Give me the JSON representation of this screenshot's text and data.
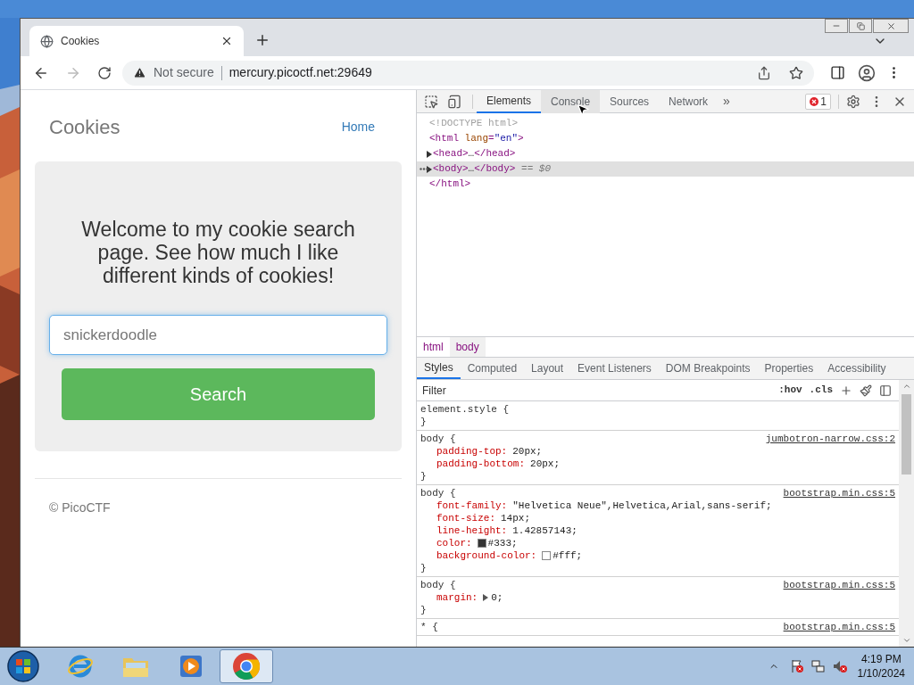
{
  "browser": {
    "tabs": [
      {
        "title": "Cookies",
        "selected": true
      }
    ],
    "address": {
      "security": "Not secure",
      "url": "mercury.picoctf.net:29649"
    }
  },
  "page": {
    "brand": "Cookies",
    "nav": [
      {
        "label": "Home"
      }
    ],
    "heading": "Welcome to my cookie search page. See how much I like different kinds of cookies!",
    "search": {
      "placeholder": "snickerdoodle"
    },
    "button": "Search",
    "footer": "© PicoCTF"
  },
  "devtools": {
    "tabs": [
      {
        "label": "Elements",
        "selected": true
      },
      {
        "label": "Console",
        "selected": false
      },
      {
        "label": "Sources",
        "selected": false
      },
      {
        "label": "Network",
        "selected": false
      }
    ],
    "more": "»",
    "error_count": "1",
    "dom": [
      {
        "kind": "doctype",
        "selected": false,
        "tokens": [
          {
            "kind": "comment",
            "text": "<!DOCTYPE html>"
          }
        ]
      },
      {
        "kind": "line",
        "selected": false,
        "tokens": [
          {
            "kind": "tag",
            "text": "<html "
          },
          {
            "kind": "attr",
            "text": "lang"
          },
          {
            "kind": "tag",
            "text": "="
          },
          {
            "kind": "value",
            "text": "\"en\""
          },
          {
            "kind": "tag",
            "text": ">"
          }
        ]
      },
      {
        "kind": "node",
        "expanded": false,
        "selected": false,
        "tokens": [
          {
            "kind": "tag",
            "text": "<head>"
          },
          {
            "kind": "plain",
            "text": "…"
          },
          {
            "kind": "tag",
            "text": "</head>"
          }
        ]
      },
      {
        "kind": "node",
        "expanded": false,
        "selected": true,
        "tokens": [
          {
            "kind": "tag",
            "text": "<body>"
          },
          {
            "kind": "plain",
            "text": "…"
          },
          {
            "kind": "tag",
            "text": "</body>"
          },
          {
            "kind": "marker",
            "text": " == $0"
          }
        ]
      },
      {
        "kind": "line",
        "selected": false,
        "tokens": [
          {
            "kind": "tag",
            "text": "</html>"
          }
        ]
      }
    ],
    "breadcrumb": [
      {
        "label": "html",
        "selected": false
      },
      {
        "label": "body",
        "selected": true
      }
    ],
    "style_tabs": [
      {
        "label": "Styles",
        "selected": true
      },
      {
        "label": "Computed",
        "selected": false
      },
      {
        "label": "Layout",
        "selected": false
      },
      {
        "label": "Event Listeners",
        "selected": false
      },
      {
        "label": "DOM Breakpoints",
        "selected": false
      },
      {
        "label": "Properties",
        "selected": false
      },
      {
        "label": "Accessibility",
        "selected": false
      }
    ],
    "filter": {
      "placeholder": "Filter"
    },
    "filter_buttons": [
      ":hov",
      ".cls"
    ],
    "rules": [
      {
        "selector": "element.style {",
        "close": "}"
      },
      {
        "selector": "body {",
        "source": "jumbotron-narrow.css:2",
        "close": "}",
        "declarations": [
          {
            "property": "padding-top:",
            "value": "20px;"
          },
          {
            "property": "padding-bottom:",
            "value": "20px;"
          }
        ]
      },
      {
        "selector": "body {",
        "source": "bootstrap.min.css:5",
        "close": "}",
        "declarations": [
          {
            "property": "font-family:",
            "value": "\"Helvetica Neue\",Helvetica,Arial,sans-serif;"
          },
          {
            "property": "font-size:",
            "value": "14px;"
          },
          {
            "property": "line-height:",
            "value": "1.42857143;"
          },
          {
            "property": "color:",
            "color": "#333333",
            "value": "#333;"
          },
          {
            "property": "background-color:",
            "color": "#ffffff",
            "value": "#fff;"
          }
        ]
      },
      {
        "selector": "body {",
        "source": "bootstrap.min.css:5",
        "close": "}",
        "declarations": [
          {
            "property": "margin:",
            "expandable": true,
            "value": "0;"
          }
        ]
      },
      {
        "selector": "* {",
        "source": "bootstrap.min.css:5"
      }
    ]
  },
  "taskbar": {
    "apps": [
      {
        "kind": "ie",
        "selected": false
      },
      {
        "kind": "folder",
        "selected": false
      },
      {
        "kind": "media",
        "selected": false
      },
      {
        "kind": "chrome",
        "selected": true
      }
    ],
    "time": "4:19 PM",
    "date": "1/10/2024"
  }
}
